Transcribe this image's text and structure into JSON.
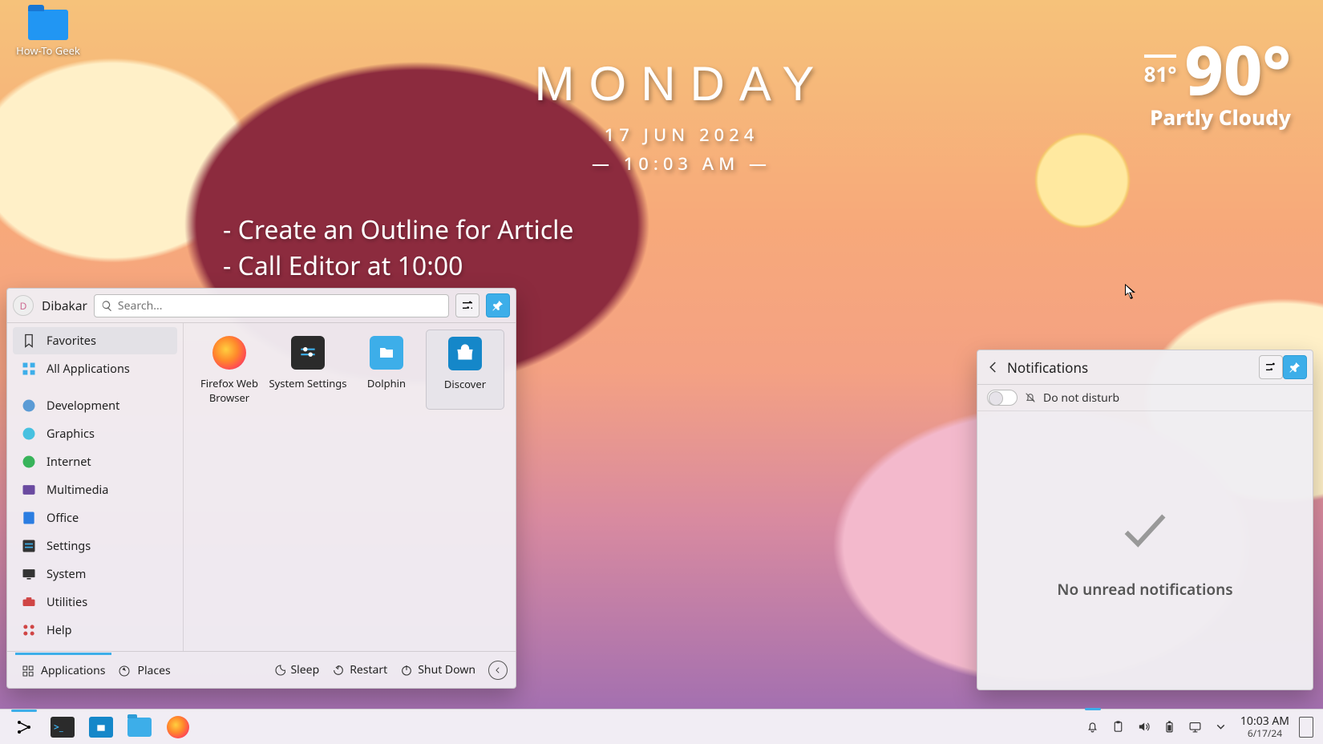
{
  "desktop": {
    "folder_label": "How-To Geek"
  },
  "clock": {
    "day": "MONDAY",
    "date": "17 JUN 2024",
    "time": "— 10:03 AM —"
  },
  "weather": {
    "temp": "90°",
    "low": "81°",
    "condition": "Partly Cloudy"
  },
  "notes": {
    "line1": "- Create an Outline for Article",
    "line2": "- Call Editor at 10:00"
  },
  "launcher": {
    "username": "Dibakar",
    "search_placeholder": "Search...",
    "sidebar": {
      "favorites": "Favorites",
      "all_apps": "All Applications",
      "categories": {
        "development": "Development",
        "graphics": "Graphics",
        "internet": "Internet",
        "multimedia": "Multimedia",
        "office": "Office",
        "settings": "Settings",
        "system": "System",
        "utilities": "Utilities",
        "help": "Help"
      }
    },
    "apps": {
      "firefox": "Firefox Web Browser",
      "system_settings": "System Settings",
      "dolphin": "Dolphin",
      "discover": "Discover"
    },
    "footer": {
      "applications": "Applications",
      "places": "Places",
      "sleep": "Sleep",
      "restart": "Restart",
      "shutdown": "Shut Down"
    }
  },
  "notifications": {
    "title": "Notifications",
    "dnd_label": "Do not disturb",
    "empty_message": "No unread notifications"
  },
  "taskbar": {
    "time": "10:03 AM",
    "date": "6/17/24"
  },
  "colors": {
    "accent": "#3daee9"
  }
}
